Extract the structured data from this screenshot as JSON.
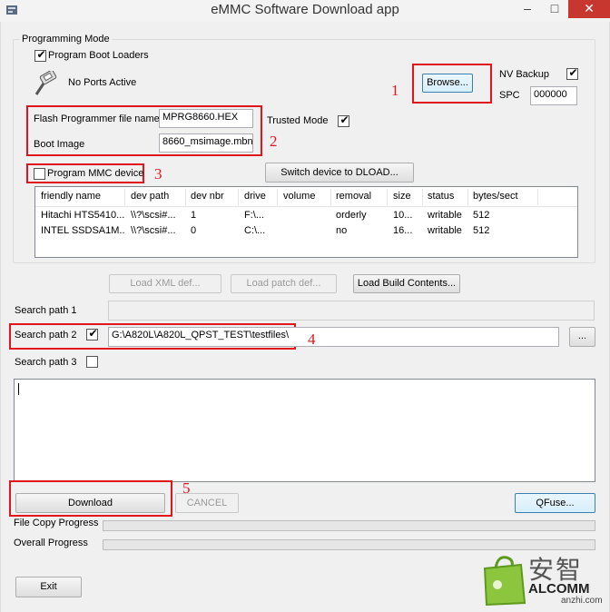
{
  "window": {
    "title": "eMMC Software Download app",
    "controls": {
      "minimize": "–",
      "maximize": "□",
      "close": "✕"
    }
  },
  "programming_mode": {
    "group_label": "Programming Mode",
    "program_boot_loaders_label": "Program Boot Loaders",
    "program_boot_loaders_checked": true,
    "ports_status": "No Ports Active",
    "browse_label": "Browse...",
    "nv_backup_label": "NV Backup",
    "nv_backup_checked": true,
    "spc_label": "SPC",
    "spc_value": "000000",
    "flash_programmer_label": "Flash Programmer file name",
    "flash_programmer_value": "MPRG8660.HEX",
    "boot_image_label": "Boot Image",
    "boot_image_value": "8660_msimage.mbn",
    "trusted_mode_label": "Trusted Mode",
    "trusted_mode_checked": true,
    "program_mmc_label": "Program MMC device",
    "program_mmc_checked": false,
    "switch_dload_label": "Switch device to DLOAD..."
  },
  "device_table": {
    "columns": [
      "friendly name",
      "dev path",
      "dev nbr",
      "drive",
      "volume",
      "removal",
      "size",
      "status",
      "bytes/sect"
    ],
    "rows": [
      [
        "Hitachi HTS5410...",
        "\\\\?\\scsi#...",
        "1",
        "F:\\...",
        "",
        "orderly",
        "10...",
        "writable",
        "512"
      ],
      [
        "INTEL SSDSA1M...",
        "\\\\?\\scsi#...",
        "0",
        "C:\\...",
        "",
        "no",
        "16...",
        "writable",
        "512"
      ]
    ]
  },
  "load_buttons": {
    "xml_def": "Load XML def...",
    "patch_def": "Load patch def...",
    "build_contents": "Load Build Contents..."
  },
  "search_paths": {
    "path1_label": "Search path 1",
    "path1_value": "",
    "path2_label": "Search path 2",
    "path2_checked": true,
    "path2_value": "G:\\A820L\\A820L_QPST_TEST\\testfiles\\",
    "path3_label": "Search path 3",
    "path3_checked": false,
    "browse_ellipsis": "..."
  },
  "actions": {
    "download": "Download",
    "cancel": "CANCEL",
    "qfuse": "QFuse...",
    "exit": "Exit"
  },
  "progress": {
    "file_copy_label": "File Copy Progress",
    "file_copy_value": 0,
    "overall_label": "Overall Progress",
    "overall_value": 0
  },
  "annotations": {
    "marker1": "1",
    "marker2": "2",
    "marker3": "3",
    "marker4": "4",
    "marker5": "5",
    "color": "#e0161c"
  },
  "watermark": {
    "brand_cn": "安智",
    "brand_en": "ALCOMM",
    "domain": "anzhi.com"
  }
}
